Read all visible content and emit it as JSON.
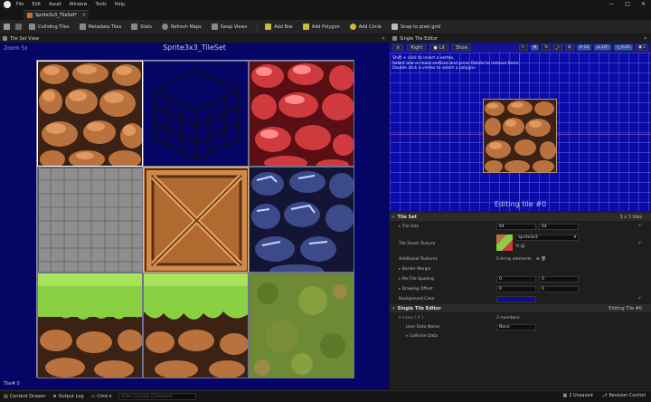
{
  "menu": {
    "items": [
      "File",
      "Edit",
      "Asset",
      "Window",
      "Tools",
      "Help"
    ]
  },
  "window_controls": {
    "minimize": "—",
    "maximize": "□",
    "close": "✕"
  },
  "document_tab": {
    "label": "Sprite3x3_TileSet*",
    "close": "✕"
  },
  "toolbar": {
    "buttons": [
      "Colliding Tiles",
      "Metadata Tiles",
      "Stats",
      "Refresh Maps",
      "Swap Views",
      "Add Box",
      "Add Polygon",
      "Add Circle",
      "Snap to pixel grid"
    ]
  },
  "left_panel": {
    "tab_label": "Tile Set View",
    "zoom": "Zoom 5x",
    "title": "Sprite3x3_TileSet",
    "status": "Tile# 0"
  },
  "right_panel": {
    "tab_label": "Single Tile Editor",
    "viewport_buttons": {
      "view": "Right",
      "lit": "Lit",
      "show": "Show"
    },
    "viewport_right": {
      "grid_size": "10",
      "rotation": "10°",
      "scale": "0.25",
      "camera": "1"
    },
    "hints": [
      "Shift + click to insert a vertex.",
      "Select one or more vertices and press Delete to remove them.",
      "Double click a vertex to select a polygon"
    ],
    "editing_label": "Editing tile #0"
  },
  "details": {
    "tile_set": {
      "header": "Tile Set",
      "summary": "3 x 3 tiles"
    },
    "tile_size": {
      "label": "Tile Size",
      "x": "64",
      "y": "64"
    },
    "tile_sheet_texture": {
      "label": "Tile Sheet Texture",
      "value": "Sprite3x3"
    },
    "additional_textures": {
      "label": "Additional Textures",
      "value": "0 Array elements"
    },
    "border_margin": {
      "label": "Border Margin"
    },
    "per_tile_spacing": {
      "label": "Per-Tile Spacing",
      "x": "0",
      "y": "0"
    },
    "drawing_offset": {
      "label": "Drawing Offset",
      "x": "0",
      "y": "0"
    },
    "background_color": {
      "label": "Background Color",
      "color": "#0c0c8c"
    },
    "single_tile_editor": {
      "header": "Single Tile Editor",
      "summary": "Editing Tile #0"
    },
    "index": {
      "label": "Index [ 0 ]",
      "value": "2 members"
    },
    "user_data_name": {
      "label": "User Data Name",
      "value": "None"
    },
    "collision_data": {
      "label": "Collision Data"
    }
  },
  "status_bar": {
    "content_drawer": "Content Drawer",
    "output_log": "Output Log",
    "cmd": "Cmd",
    "cmd_placeholder": "Enter Console Command",
    "unsaved": "2 Unsaved",
    "revision_control": "Revision Control"
  },
  "colors": {
    "viewport_bg": "#0b0ba8",
    "tileset_bg": "#050566",
    "accent": "#2f5fb0"
  }
}
